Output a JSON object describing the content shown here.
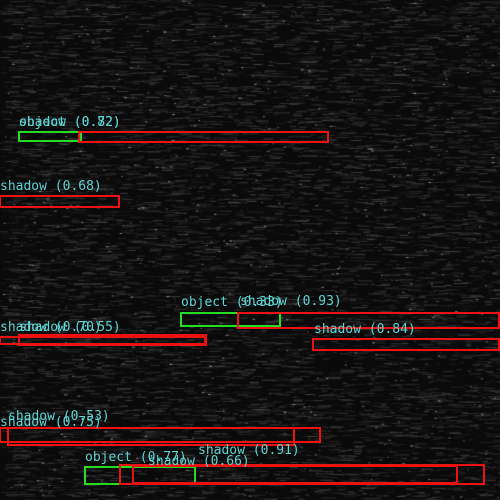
{
  "image": {
    "description_colors": {
      "background": "#0a0a0a",
      "streak": "#3a3a3a"
    }
  },
  "detections": [
    {
      "cls": "object",
      "score": "0.72",
      "label": "object (0.72)",
      "color": "#22dd22",
      "text_color": "#5fd4d4"
    },
    {
      "cls": "shadow",
      "score": "0.82",
      "label": "shadow (0.82)",
      "color": "#ee1111",
      "text_color": "#5fd4d4"
    },
    {
      "cls": "shadow",
      "score": "0.68",
      "label": "shadow (0.68)",
      "color": "#ee1111",
      "text_color": "#5fd4d4"
    },
    {
      "cls": "shadow",
      "score": "0.70",
      "label": "shadow (0.70)",
      "color": "#ee1111",
      "text_color": "#5fd4d4"
    },
    {
      "cls": "shadow",
      "score": "0.55",
      "label": "shadow (0.55)",
      "color": "#ee1111",
      "text_color": "#5fd4d4"
    },
    {
      "cls": "object",
      "score": "0.33",
      "label": "object (0.33)",
      "color": "#22dd22",
      "text_color": "#5fd4d4"
    },
    {
      "cls": "shadow",
      "score": "0.93",
      "label": "shadow (0.93)",
      "color": "#ee1111",
      "text_color": "#5fd4d4"
    },
    {
      "cls": "shadow",
      "score": "0.84",
      "label": "shadow (0.84)",
      "color": "#ee1111",
      "text_color": "#5fd4d4"
    },
    {
      "cls": "shadow",
      "score": "0.53",
      "label": "shadow (0.53)",
      "color": "#ee1111",
      "text_color": "#5fd4d4"
    },
    {
      "cls": "shadow",
      "score": "0.75",
      "label": "shadow (0.75)",
      "color": "#ee1111",
      "text_color": "#5fd4d4"
    },
    {
      "cls": "object",
      "score": "0.77",
      "label": "object (0.77)",
      "color": "#22dd22",
      "text_color": "#5fd4d4"
    },
    {
      "cls": "shadow",
      "score": "0.91",
      "label": "shadow (0.91)",
      "color": "#ee1111",
      "text_color": "#5fd4d4"
    },
    {
      "cls": "shadow",
      "score": "0.66",
      "label": "shadow (0.66)",
      "color": "#ee1111",
      "text_color": "#5fd4d4"
    }
  ]
}
